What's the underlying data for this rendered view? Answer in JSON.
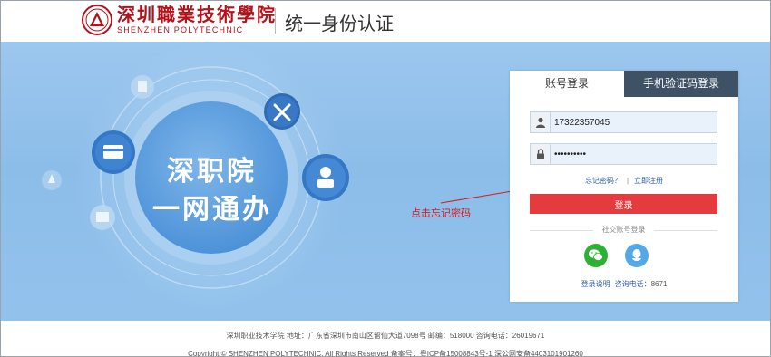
{
  "header": {
    "school_name_cn": "深圳職業技術學院",
    "school_name_en": "SHENZHEN POLYTECHNIC",
    "system_title": "统一身份认证"
  },
  "hero": {
    "slogan_line1": "深职院",
    "slogan_line2": "一网通办",
    "icons": [
      "document-icon",
      "tools-icon",
      "card-icon",
      "user-badge-icon",
      "id-card-icon",
      "rocket-icon"
    ]
  },
  "annotation": {
    "text": "点击忘记密码",
    "color": "#d21b1b"
  },
  "login": {
    "tabs": [
      {
        "label": "账号登录",
        "active": true
      },
      {
        "label": "手机验证码登录",
        "active": false
      }
    ],
    "username_value": "17322357045",
    "password_value": "••••••••••",
    "forgot_password": "忘记密码？",
    "separator": "|",
    "register": "立即注册",
    "login_button": "登录",
    "social_label": "社交账号登录",
    "social": [
      {
        "name": "wechat",
        "color": "#2cb132"
      },
      {
        "name": "qq",
        "color": "#53a8ea"
      }
    ],
    "help_link": "登录说明",
    "phone_label": "咨询电话：",
    "phone_number": "8671"
  },
  "footer": {
    "line1": "深圳职业技术学院 地址：广东省深圳市南山区留仙大道7098号 邮编：518000 咨询电话：26019671",
    "line2": "Copyright © SHENZHEN POLYTECHNIC. All Rights Reserved 备案号：粤ICP备15008843号-1 深公网安备4403101901260"
  },
  "colors": {
    "brand_red": "#b3121b",
    "hero_blue": "#8cbde9",
    "tab_dark": "#3e5165",
    "login_red": "#e43b3f"
  }
}
